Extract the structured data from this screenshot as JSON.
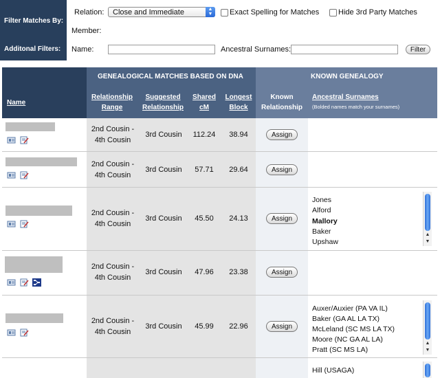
{
  "filter": {
    "title": "Filter Matches By:",
    "additional": "Additonal Filters:",
    "relation_label": "Relation:",
    "relation_value": "Close and Immediate",
    "exact_spelling": "Exact Spelling for Matches",
    "hide_3rd_party": "Hide 3rd Party Matches",
    "member_label": "Member:",
    "name_label": "Name:",
    "ancestral_label": "Ancestral Surnames:",
    "filter_button": "Filter"
  },
  "table": {
    "name_header": "Name",
    "dna_group": "GENEALOGICAL MATCHES BASED ON DNA",
    "known_group": "KNOWN GENEALOGY",
    "col_range": [
      "Relationship",
      "Range"
    ],
    "col_suggested": [
      "Suggested",
      "Relationship"
    ],
    "col_shared": [
      "Shared",
      "cM"
    ],
    "col_longest": [
      "Longest",
      "Block"
    ],
    "col_known": [
      "Known",
      "Relationship"
    ],
    "col_surnames": "Ancestral Surnames",
    "surnames_note": "(Bolded names match your surnames)",
    "assign_label": "Assign"
  },
  "rows": [
    {
      "range": [
        "2nd Cousin -",
        "4th Cousin"
      ],
      "suggested": "3rd Cousin",
      "shared": "112.24",
      "longest": "38.94",
      "surnames": []
    },
    {
      "range": [
        "2nd Cousin -",
        "4th Cousin"
      ],
      "suggested": "3rd Cousin",
      "shared": "57.71",
      "longest": "29.64",
      "surnames": []
    },
    {
      "range": [
        "2nd Cousin -",
        "4th Cousin"
      ],
      "suggested": "3rd Cousin",
      "shared": "45.50",
      "longest": "24.13",
      "surnames": [
        "Jones",
        "Alford",
        "Mallory",
        "Baker",
        "Upshaw"
      ],
      "bold": [
        2
      ]
    },
    {
      "range": [
        "2nd Cousin -",
        "4th Cousin"
      ],
      "suggested": "3rd Cousin",
      "shared": "47.96",
      "longest": "23.38",
      "surnames": []
    },
    {
      "range": [
        "2nd Cousin -",
        "4th Cousin"
      ],
      "suggested": "3rd Cousin",
      "shared": "45.99",
      "longest": "22.96",
      "surnames": [
        "Auxer/Auxier (PA VA IL)",
        "Baker (GA AL LA TX)",
        "McLeland (SC MS LA TX)",
        "Moore (NC GA AL LA)",
        "Pratt (SC MS LA)"
      ]
    },
    {
      "surnames": [
        "Hill (USAGA)"
      ]
    }
  ],
  "icons": [
    "profile-icon",
    "notes-icon",
    "tree-icon"
  ]
}
